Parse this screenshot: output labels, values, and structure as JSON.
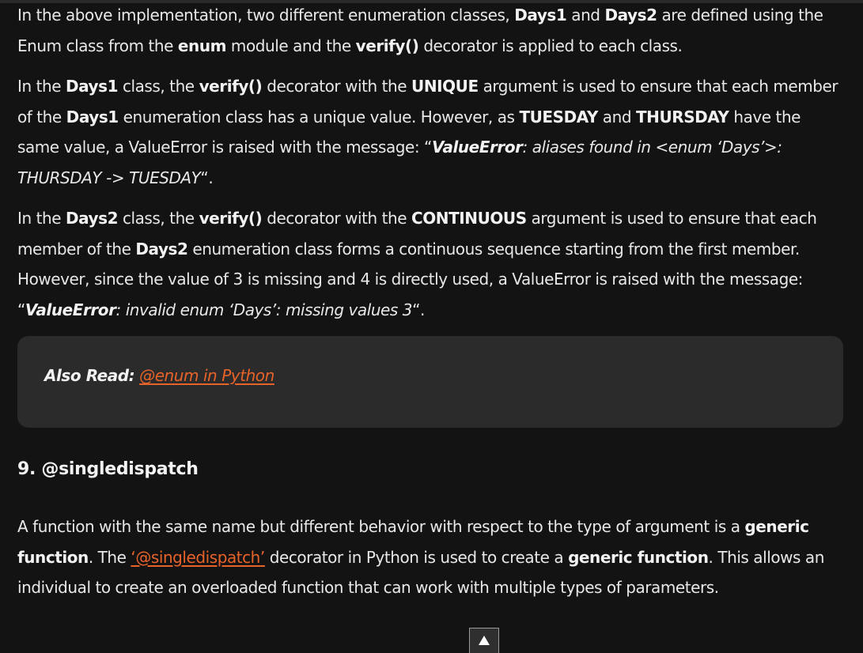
{
  "para1": {
    "t1": "In the above implementation, two different enumeration classes, ",
    "b1": "Days1",
    "t2": " and ",
    "b2": "Days2",
    "t3": " are defined using the Enum class from the ",
    "b3": "enum",
    "t4": " module and the ",
    "b4": "verify()",
    "t5": " decorator is applied to each class."
  },
  "para2": {
    "t1": "In the ",
    "b1": "Days1",
    "t2": " class, the ",
    "b2": "verify()",
    "t3": " decorator with the ",
    "b3": "UNIQUE",
    "t4": " argument is used to ensure that each member of the ",
    "b4": "Days1",
    "t5": " enumeration class has a unique value. However, as ",
    "b5": "TUESDAY",
    "t6": " and ",
    "b6": "THURSDAY",
    "t7": " have the same value, a ValueError is raised with the message: “",
    "bi1": "ValueError",
    "i1": ": aliases found in <enum ‘Days’>: THURSDAY -> TUESDAY",
    "t8": "“."
  },
  "para3": {
    "t1": "In the ",
    "b1": "Days2",
    "t2": " class, the ",
    "b2": "verify()",
    "t3": " decorator with the ",
    "b3": "CONTINUOUS",
    "t4": " argument is used to ensure that each member of the ",
    "b4": "Days2",
    "t5": " enumeration class forms a continuous sequence starting from the first member. However, since the value of 3 is missing and 4 is directly used, a ValueError is raised with the message: “",
    "bi1": "ValueError",
    "i1": ": invalid enum ‘Days’: missing values 3",
    "t6": "“."
  },
  "callout": {
    "label": "Also Read:",
    "link_text": "@enum in Python"
  },
  "section": {
    "heading": "9. @singledispatch"
  },
  "para4": {
    "t1": "A function with the same name but different behavior with respect to the type of argument is a ",
    "b1": "generic function",
    "t2": ".  The ",
    "link": "‘@singledispatch’",
    "t3": " decorator in Python is used to create a ",
    "b2": "generic function",
    "t4": ". This allows an individual to create an overloaded function that can work with multiple types of parameters."
  },
  "colors": {
    "background": "#131313",
    "callout_bg": "#2b2b2b",
    "link": "#e8632a",
    "text": "#e8e8e8"
  },
  "icons": {
    "scroll_top": "arrow-up-icon"
  }
}
